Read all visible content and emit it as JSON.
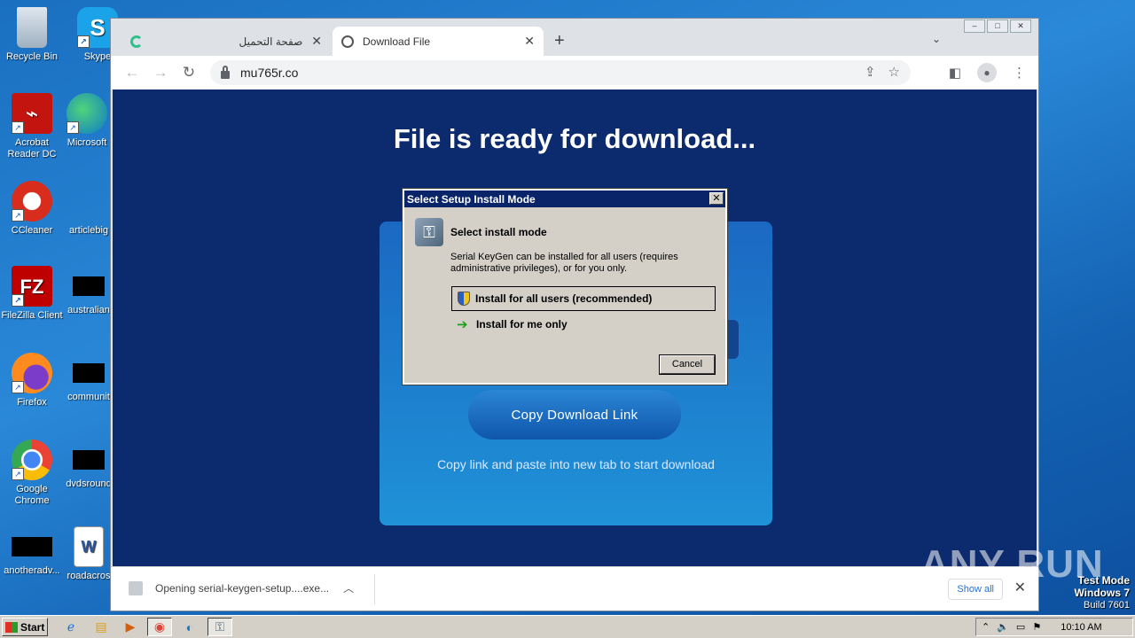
{
  "desktop": {
    "icons": [
      {
        "label": "Recycle Bin"
      },
      {
        "label": "Skype"
      },
      {
        "label": "Acrobat Reader DC"
      },
      {
        "label": "Microsoft"
      },
      {
        "label": "CCleaner"
      },
      {
        "label": "articlebig"
      },
      {
        "label": "FileZilla Client"
      },
      {
        "label": "australian"
      },
      {
        "label": "Firefox"
      },
      {
        "label": "communit"
      },
      {
        "label": "Google Chrome"
      },
      {
        "label": "dvdsround"
      },
      {
        "label": "anotheradv..."
      },
      {
        "label": "roadacros"
      }
    ]
  },
  "browser": {
    "tabs": [
      {
        "label": "صفحة التحميل",
        "active": false
      },
      {
        "label": "Download File",
        "active": true
      }
    ],
    "new_tab": "+",
    "address": "mu765r.co"
  },
  "page": {
    "title": "File is ready for download...",
    "copy_button": "Copy Download Link",
    "hint": "Copy link and paste into new tab to start download"
  },
  "dialog": {
    "title": "Select Setup Install Mode",
    "heading": "Select install mode",
    "description": "Serial KeyGen can be installed for all users (requires administrative privileges), or for you only.",
    "option_all": "Install for all users (recommended)",
    "option_me": "Install for me only",
    "cancel": "Cancel"
  },
  "download_bar": {
    "item": "Opening serial-keygen-setup....exe...",
    "show_all": "Show all"
  },
  "taskbar": {
    "start": "Start",
    "clock": "10:10 AM"
  },
  "system": {
    "line1": "Test Mode",
    "line2": "Windows 7",
    "line3": "Build 7601",
    "watermark": "ANY RUN"
  },
  "colors": {
    "page_background": "#0c2a6e",
    "card": "#1f92d8",
    "dialog_title": "#0a246a"
  }
}
